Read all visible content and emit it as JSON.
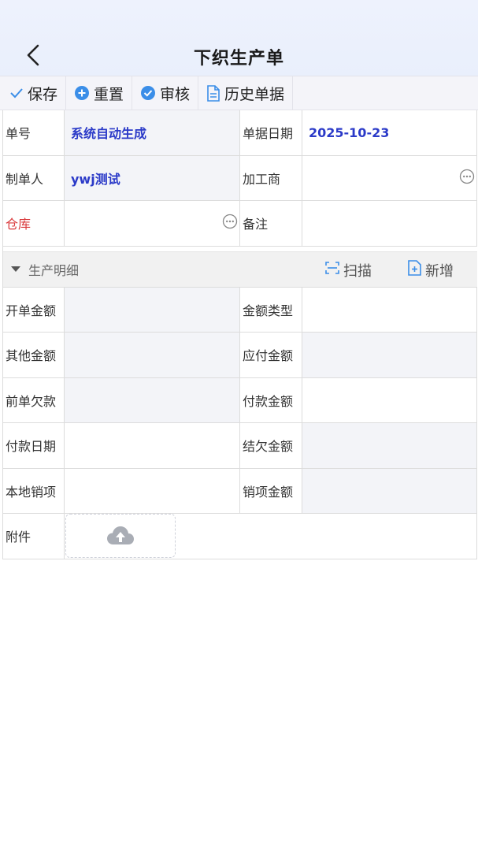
{
  "header": {
    "title": "下织生产单"
  },
  "toolbar": {
    "save": "保存",
    "reset": "重置",
    "audit": "审核",
    "history": "历史单据"
  },
  "form": {
    "row1": {
      "label1": "单号",
      "value1": "系统自动生成",
      "label2": "单据日期",
      "value2": "2025-10-23"
    },
    "row2": {
      "label1": "制单人",
      "value1": "ywj测试",
      "label2": "加工商",
      "value2": ""
    },
    "row3": {
      "label1": "仓库",
      "value1": "",
      "label2": "备注",
      "value2": ""
    }
  },
  "section": {
    "title": "生产明细",
    "scan": "扫描",
    "add": "新增"
  },
  "amounts": {
    "row1": {
      "label1": "开单金额",
      "value1": "",
      "label2": "金额类型",
      "value2": ""
    },
    "row2": {
      "label1": "其他金额",
      "value1": "",
      "label2": "应付金额",
      "value2": ""
    },
    "row3": {
      "label1": "前单欠款",
      "value1": "",
      "label2": "付款金额",
      "value2": ""
    },
    "row4": {
      "label1": "付款日期",
      "value1": "",
      "label2": "结欠金额",
      "value2": ""
    },
    "row5": {
      "label1": "本地销项",
      "value1": "",
      "label2": "销项金额",
      "value2": ""
    }
  },
  "attachment": {
    "label": "附件"
  },
  "colors": {
    "accent": "#2b3ac8",
    "required": "#d9383a",
    "icon_blue": "#3b8ee8"
  }
}
